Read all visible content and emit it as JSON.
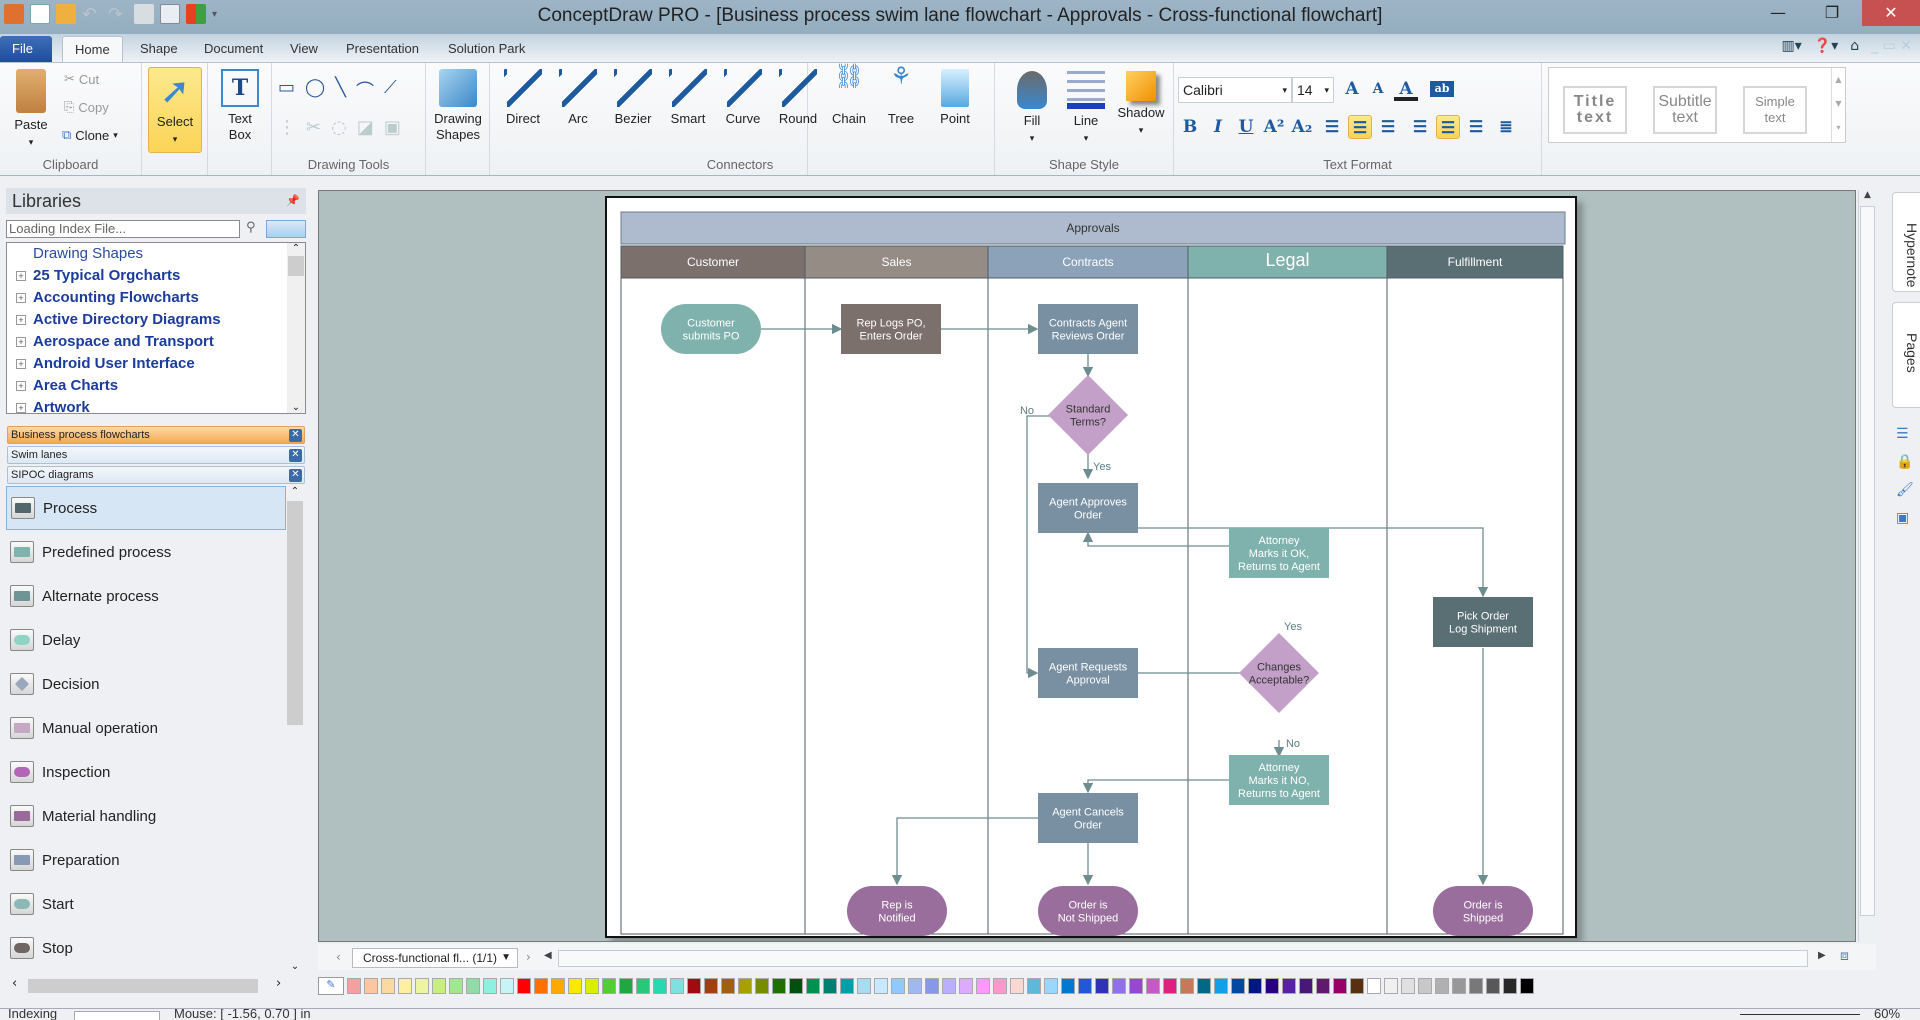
{
  "window": {
    "title": "ConceptDraw PRO - [Business process swim lane flowchart - Approvals - Cross-functional flowchart]",
    "minimize": "—",
    "maximize": "❐",
    "close": "✕"
  },
  "tabs": [
    "File",
    "Home",
    "Shape",
    "Document",
    "View",
    "Presentation",
    "Solution Park"
  ],
  "active_tab": "Home",
  "ribbon": {
    "clipboard": {
      "label": "Clipboard",
      "paste": "Paste",
      "cut": "Cut",
      "copy": "Copy",
      "clone": "Clone"
    },
    "select": {
      "label": "Select"
    },
    "text_box": {
      "label": "Text Box"
    },
    "drawing_tools": {
      "label": "Drawing Tools"
    },
    "drawing_shapes": {
      "label": "Drawing Shapes"
    },
    "connectors": {
      "label": "Connectors",
      "items": [
        "Direct",
        "Arc",
        "Bezier",
        "Smart",
        "Curve",
        "Round"
      ],
      "chain": "Chain",
      "tree": "Tree",
      "point": "Point"
    },
    "shape_style": {
      "label": "Shape Style",
      "fill": "Fill",
      "line": "Line",
      "shadow": "Shadow"
    },
    "text_format": {
      "label": "Text Format",
      "font": "Calibri",
      "size": "14"
    },
    "styles": {
      "title": "Title text",
      "subtitle": "Subtitle text",
      "simple": "Simple text"
    }
  },
  "libraries": {
    "title": "Libraries",
    "search_placeholder": "Loading Index File...",
    "tree": [
      "Drawing Shapes",
      "25 Typical Orgcharts",
      "Accounting Flowcharts",
      "Active Directory Diagrams",
      "Aerospace and Transport",
      "Android User Interface",
      "Area Charts",
      "Artwork"
    ],
    "open_libraries": [
      "Business process flowcharts",
      "Swim lanes",
      "SIPOC diagrams"
    ],
    "shapes": [
      {
        "name": "Process",
        "color": "#51676b"
      },
      {
        "name": "Predefined process",
        "color": "#7fb3ae"
      },
      {
        "name": "Alternate process",
        "color": "#6f9496"
      },
      {
        "name": "Delay",
        "color": "#8fd3c4"
      },
      {
        "name": "Decision",
        "color": "#9aa8bc"
      },
      {
        "name": "Manual operation",
        "color": "#c4a8c6"
      },
      {
        "name": "Inspection",
        "color": "#b166b8"
      },
      {
        "name": "Material handling",
        "color": "#9a6a9b"
      },
      {
        "name": "Preparation",
        "color": "#8899b4"
      },
      {
        "name": "Start",
        "color": "#8cb8b6"
      },
      {
        "name": "Stop",
        "color": "#6f6563"
      }
    ]
  },
  "diagram": {
    "title": "Approvals",
    "lanes": [
      {
        "name": "Customer",
        "color": "#7b706b"
      },
      {
        "name": "Sales",
        "color": "#958c86"
      },
      {
        "name": "Contracts",
        "color": "#8ca2b9"
      },
      {
        "name": "Legal",
        "color": "#7fb2ad"
      },
      {
        "name": "Fulfillment",
        "color": "#5a6f74"
      }
    ],
    "nodes": {
      "customer_submits": "Customer|submits PO",
      "rep_logs": "Rep Logs PO,|Enters Order",
      "agent_reviews": "Contracts Agent|Reviews Order",
      "standard_terms": "Standard|Terms?",
      "agent_approves": "Agent Approves|Order",
      "attorney_ok": "Attorney|Marks it OK,|Returns to Agent",
      "pick_order": "Pick Order|Log Shipment",
      "agent_requests": "Agent Requests|Approval",
      "changes_acceptable": "Changes|Acceptable?",
      "attorney_no": "Attorney|Marks it NO,|Returns to Agent",
      "agent_cancels": "Agent Cancels|Order",
      "rep_notified": "Rep is|Notified",
      "not_shipped": "Order is|Not Shipped",
      "shipped": "Order is|Shipped"
    },
    "labels": {
      "no": "No",
      "yes": "Yes"
    }
  },
  "page_tab": "Cross-functional fl... (1/1)",
  "right_dock": {
    "hypernote": "Hypernote",
    "pages": "Pages"
  },
  "palette": [
    "#f4a0a0",
    "#fbc6a0",
    "#fcd9a0",
    "#fdf0a0",
    "#eef5a0",
    "#c6ef80",
    "#a0e890",
    "#90dca8",
    "#90f0e0",
    "#c8f4f8",
    "#ff0000",
    "#ff7000",
    "#ffa800",
    "#ffe800",
    "#d8f000",
    "#50d030",
    "#20a840",
    "#28c878",
    "#28d8b0",
    "#80e0e0",
    "#a00a10",
    "#a04010",
    "#a06010",
    "#a8a000",
    "#788c00",
    "#207000",
    "#005010",
    "#009050",
    "#008070",
    "#00a0a8",
    "#a8dcf0",
    "#c8e8ff",
    "#90c8ff",
    "#a0b8f0",
    "#8898e8",
    "#b8b0ff",
    "#dcaaff",
    "#ff98ff",
    "#ff98cc",
    "#f8d8d0",
    "#60b8d8",
    "#98d8ff",
    "#0078d0",
    "#2058d8",
    "#3030b8",
    "#9070e8",
    "#9848d0",
    "#c858c8",
    "#e02080",
    "#c87858",
    "#006888",
    "#10a0e8",
    "#0048a0",
    "#001880",
    "#280080",
    "#5820a8",
    "#481878",
    "#601870",
    "#980068",
    "#583010",
    "#ffffff",
    "#f0f0f0",
    "#e0e0e0",
    "#c8c8c8",
    "#b0b0b0",
    "#989898",
    "#787878",
    "#585858",
    "#282828",
    "#000000"
  ],
  "status": {
    "indexing": "Indexing",
    "mouse": "Mouse: [ -1.56, 0.70 ] in",
    "zoom": "60%"
  }
}
